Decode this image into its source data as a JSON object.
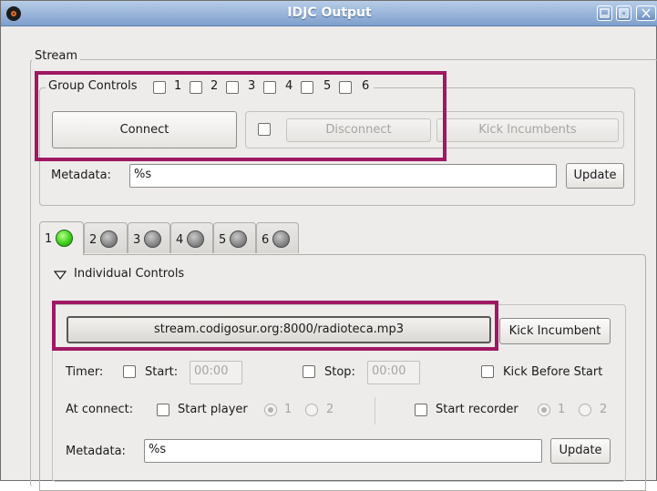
{
  "window": {
    "title": "IDJC Output"
  },
  "stream": {
    "frame_label": "Stream",
    "group_controls": {
      "label": "Group Controls",
      "groups": [
        "1",
        "2",
        "3",
        "4",
        "5",
        "6"
      ]
    },
    "connect_label": "Connect",
    "disconnect_label": "Disconnect",
    "kick_incumbents_label": "Kick Incumbents",
    "metadata_label": "Metadata:",
    "metadata_value": "%s",
    "update_label": "Update"
  },
  "tabs": [
    {
      "label": "1",
      "status": "connected"
    },
    {
      "label": "2",
      "status": "idle"
    },
    {
      "label": "3",
      "status": "idle"
    },
    {
      "label": "4",
      "status": "idle"
    },
    {
      "label": "5",
      "status": "idle"
    },
    {
      "label": "6",
      "status": "idle"
    }
  ],
  "individual": {
    "expander_label": "Individual Controls",
    "stream_button_label": "stream.codigosur.org:8000/radioteca.mp3",
    "kick_incumbent_label": "Kick Incumbent",
    "timer_label": "Timer:",
    "start_label": "Start:",
    "start_value": "00:00",
    "stop_label": "Stop:",
    "stop_value": "00:00",
    "kick_before_start_label": "Kick Before Start",
    "at_connect_label": "At connect:",
    "start_player_label": "Start player",
    "start_recorder_label": "Start recorder",
    "player_options": [
      "1",
      "2"
    ],
    "recorder_options": [
      "1",
      "2"
    ],
    "metadata_label": "Metadata:",
    "metadata_value": "%s",
    "update_label": "Update"
  },
  "colors": {
    "titlebar": "#7e9fcc",
    "highlight": "#a01863",
    "connected_led": "#3fcf1b",
    "idle_led": "#7a7a7a"
  }
}
